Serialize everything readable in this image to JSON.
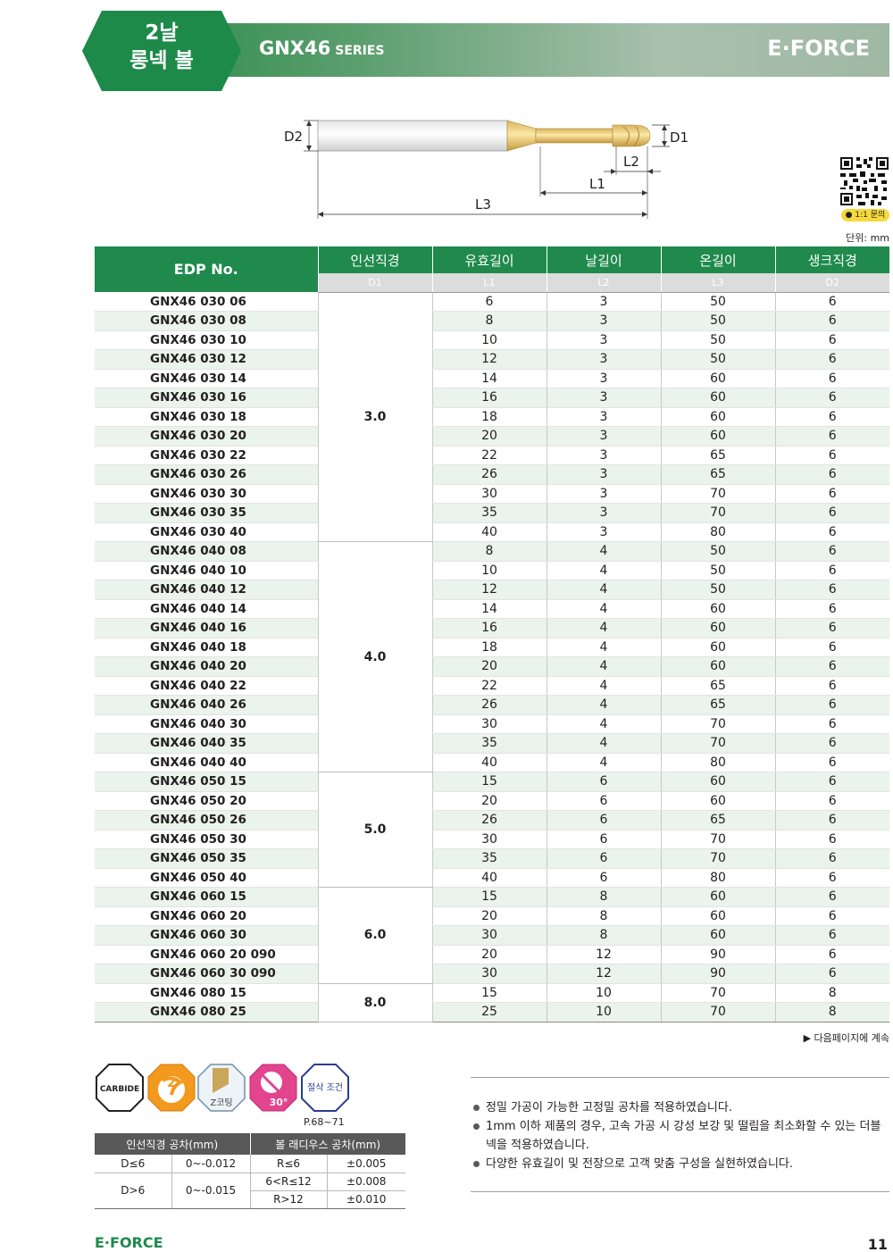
{
  "header": {
    "badge_line1": "2날",
    "badge_line2": "롱넥 볼",
    "series_name": "GNX46",
    "series_suffix": "SERIES",
    "brand": "E·FORCE"
  },
  "drawing": {
    "labels": {
      "D1": "D1",
      "D2": "D2",
      "L1": "L1",
      "L2": "L2",
      "L3": "L3"
    }
  },
  "qr": {
    "label": "1:1 문의"
  },
  "unit": "단위: mm",
  "table": {
    "headers": {
      "edp": "EDP No.",
      "col1": "인선직경",
      "col2": "유효길이",
      "col3": "날길이",
      "col4": "온길이",
      "col5": "생크직경"
    },
    "subheaders": [
      "D1",
      "L1",
      "L2",
      "L3",
      "D2"
    ],
    "groups": [
      {
        "diameter": "3.0",
        "rows": [
          [
            "GNX46 030 06",
            "6",
            "3",
            "50",
            "6"
          ],
          [
            "GNX46 030 08",
            "8",
            "3",
            "50",
            "6"
          ],
          [
            "GNX46 030 10",
            "10",
            "3",
            "50",
            "6"
          ],
          [
            "GNX46 030 12",
            "12",
            "3",
            "50",
            "6"
          ],
          [
            "GNX46 030 14",
            "14",
            "3",
            "60",
            "6"
          ],
          [
            "GNX46 030 16",
            "16",
            "3",
            "60",
            "6"
          ],
          [
            "GNX46 030 18",
            "18",
            "3",
            "60",
            "6"
          ],
          [
            "GNX46 030 20",
            "20",
            "3",
            "60",
            "6"
          ],
          [
            "GNX46 030 22",
            "22",
            "3",
            "65",
            "6"
          ],
          [
            "GNX46 030 26",
            "26",
            "3",
            "65",
            "6"
          ],
          [
            "GNX46 030 30",
            "30",
            "3",
            "70",
            "6"
          ],
          [
            "GNX46 030 35",
            "35",
            "3",
            "70",
            "6"
          ],
          [
            "GNX46 030 40",
            "40",
            "3",
            "80",
            "6"
          ]
        ]
      },
      {
        "diameter": "4.0",
        "rows": [
          [
            "GNX46 040 08",
            "8",
            "4",
            "50",
            "6"
          ],
          [
            "GNX46 040 10",
            "10",
            "4",
            "50",
            "6"
          ],
          [
            "GNX46 040 12",
            "12",
            "4",
            "50",
            "6"
          ],
          [
            "GNX46 040 14",
            "14",
            "4",
            "60",
            "6"
          ],
          [
            "GNX46 040 16",
            "16",
            "4",
            "60",
            "6"
          ],
          [
            "GNX46 040 18",
            "18",
            "4",
            "60",
            "6"
          ],
          [
            "GNX46 040 20",
            "20",
            "4",
            "60",
            "6"
          ],
          [
            "GNX46 040 22",
            "22",
            "4",
            "65",
            "6"
          ],
          [
            "GNX46 040 26",
            "26",
            "4",
            "65",
            "6"
          ],
          [
            "GNX46 040 30",
            "30",
            "4",
            "70",
            "6"
          ],
          [
            "GNX46 040 35",
            "35",
            "4",
            "70",
            "6"
          ],
          [
            "GNX46 040 40",
            "40",
            "4",
            "80",
            "6"
          ]
        ]
      },
      {
        "diameter": "5.0",
        "rows": [
          [
            "GNX46 050 15",
            "15",
            "6",
            "60",
            "6"
          ],
          [
            "GNX46 050 20",
            "20",
            "6",
            "60",
            "6"
          ],
          [
            "GNX46 050 26",
            "26",
            "6",
            "65",
            "6"
          ],
          [
            "GNX46 050 30",
            "30",
            "6",
            "70",
            "6"
          ],
          [
            "GNX46 050 35",
            "35",
            "6",
            "70",
            "6"
          ],
          [
            "GNX46 050 40",
            "40",
            "6",
            "80",
            "6"
          ]
        ]
      },
      {
        "diameter": "6.0",
        "rows": [
          [
            "GNX46 060 15",
            "15",
            "8",
            "60",
            "6"
          ],
          [
            "GNX46 060 20",
            "20",
            "8",
            "60",
            "6"
          ],
          [
            "GNX46 060 30",
            "30",
            "8",
            "60",
            "6"
          ],
          [
            "GNX46 060 20 090",
            "20",
            "12",
            "90",
            "6"
          ],
          [
            "GNX46 060 30 090",
            "30",
            "12",
            "90",
            "6"
          ]
        ]
      },
      {
        "diameter": "8.0",
        "rows": [
          [
            "GNX46 080 15",
            "15",
            "10",
            "70",
            "8"
          ],
          [
            "GNX46 080 25",
            "25",
            "10",
            "70",
            "8"
          ]
        ]
      }
    ]
  },
  "continue_note": "▶ 다음페이지에 계속",
  "icons": {
    "carbide": "CARBIDE",
    "flutes": "2",
    "coating": "Z코팅",
    "helix": "30°",
    "cutting": "절삭 조건",
    "reference": "P.68~71"
  },
  "tolerance": {
    "header_left": "인선직경 공차(mm)",
    "header_right": "볼 래디우스 공차(mm)",
    "rows": [
      {
        "cond": "D≤6",
        "tol": "0~-0.012",
        "r": "R≤6",
        "rtol": "±0.005"
      },
      {
        "cond": "D>6",
        "tol": "0~-0.015",
        "r": "6<R≤12",
        "rtol": "±0.008"
      },
      {
        "r": "R>12",
        "rtol": "±0.010"
      }
    ]
  },
  "notes": [
    "정밀 가공이 가능한 고정밀 공차를 적용하였습니다.",
    "1mm 이하 제품의 경우, 고속 가공 시 강성 보강 및 떨림을 최소화할 수 있는 더블넥을 적용하였습니다.",
    "다양한 유효길이 및 전장으로 고객 맞춤 구성을 실현하였습니다."
  ],
  "footer": {
    "brand": "E·FORCE",
    "page": "11"
  }
}
